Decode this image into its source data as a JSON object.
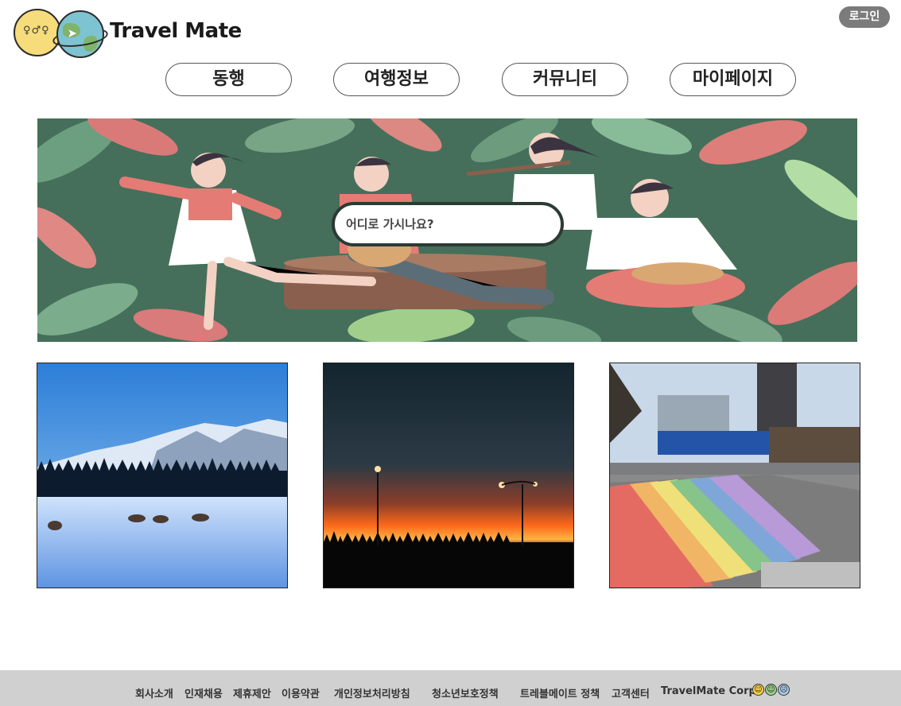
{
  "header": {
    "brand": "Travel Mate",
    "login_label": "로그인"
  },
  "nav": {
    "items": [
      {
        "label": "동행"
      },
      {
        "label": "여행정보"
      },
      {
        "label": "커뮤니티"
      },
      {
        "label": "마이페이지"
      }
    ]
  },
  "hero": {
    "search_placeholder": "어디로 가시나요?"
  },
  "photos": [
    {
      "subject": "snowy mountain meadow with grazing elk"
    },
    {
      "subject": "orange sunset with street lamps"
    },
    {
      "subject": "rainbow crosswalk at city intersection"
    }
  ],
  "footer": {
    "links": [
      {
        "label": "회사소개"
      },
      {
        "label": "인재채용"
      },
      {
        "label": "제휴제안"
      },
      {
        "label": "이용약관"
      },
      {
        "label": "개인정보처리방침"
      },
      {
        "label": "청소년보호정책"
      },
      {
        "label": "트레블메이트 정책"
      },
      {
        "label": "고객센터"
      }
    ],
    "corp": "TravelMate Corp"
  },
  "colors": {
    "login_bg": "#7b7b7b",
    "footer_bg": "#d0d0d0",
    "hero_green": "#3f6a55",
    "hero_pink": "#e87f7f"
  }
}
